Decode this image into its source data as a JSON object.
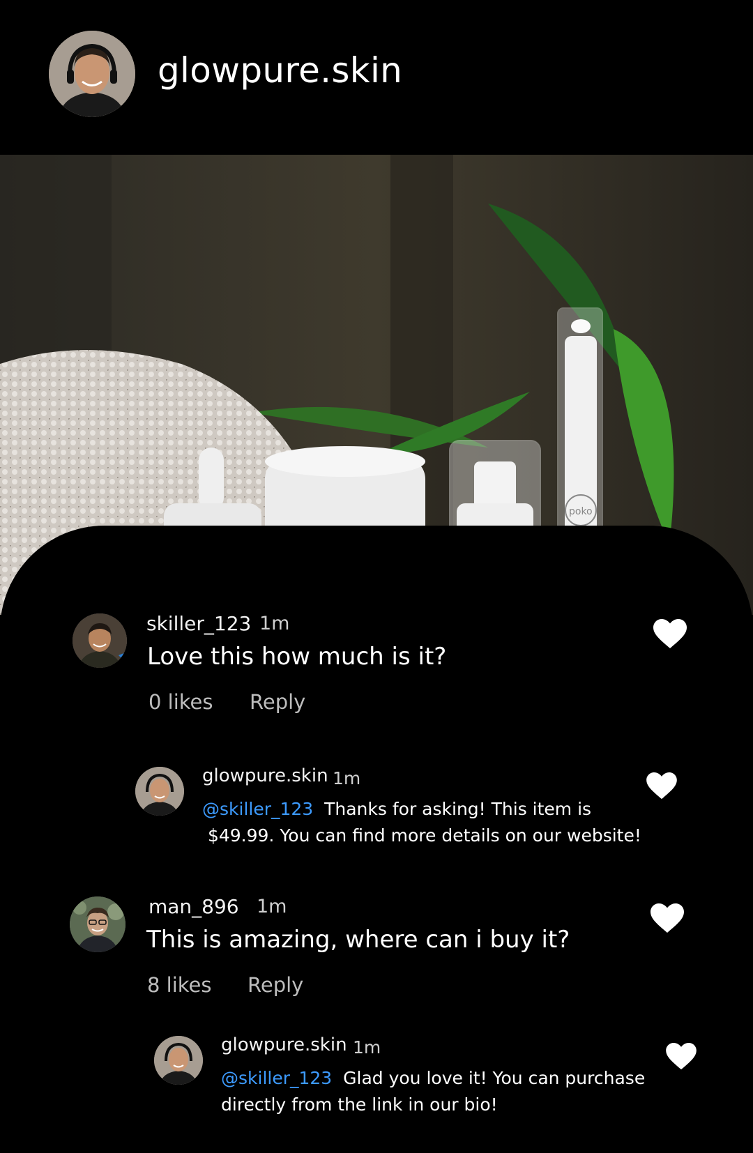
{
  "header": {
    "username": "glowpure.skin"
  },
  "comments": [
    {
      "username": "skiller_123",
      "time": "1m",
      "text": "Love this how much is it?",
      "likes": "0 likes",
      "reply": "Reply",
      "reply_item": {
        "username": "glowpure.skin",
        "time": "1m",
        "mention": "@skiller_123",
        "text_line1": "Thanks for asking! This item is",
        "text_line2": "$49.99. You can find more details on our website!"
      }
    },
    {
      "username": "man_896",
      "time": "1m",
      "text": "This is amazing, where can i buy it?",
      "likes": "8 likes",
      "reply": "Reply",
      "reply_item": {
        "username": "glowpure.skin",
        "time": "1m",
        "mention": "@skiller_123",
        "text_line1": "Glad you love it! You can purchase",
        "text_line2": "directly from the link in our bio!"
      }
    }
  ],
  "photo": {
    "brand_mark": "poko"
  },
  "icons": {
    "heart": "heart-icon",
    "avatar": "avatar"
  }
}
